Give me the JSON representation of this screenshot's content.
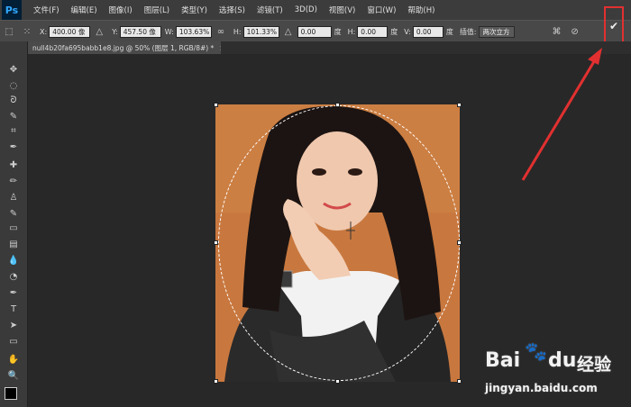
{
  "app": {
    "logo": "Ps"
  },
  "menu": [
    "文件(F)",
    "编辑(E)",
    "图像(I)",
    "图层(L)",
    "类型(Y)",
    "选择(S)",
    "滤镜(T)",
    "3D(D)",
    "视图(V)",
    "窗口(W)",
    "帮助(H)"
  ],
  "options": {
    "x_label": "X:",
    "x_value": "400.00 像",
    "y_label": "Y:",
    "y_value": "457.50 像",
    "w_label": "W:",
    "w_value": "103.63%",
    "h_label": "H:",
    "h_value": "101.33%",
    "angle_value": "0.00",
    "angle_unit": "度",
    "hskew_label": "H:",
    "hskew_value": "0.00",
    "hskew_unit": "度",
    "vskew_label": "V:",
    "vskew_value": "0.00",
    "vskew_unit": "度",
    "interp_label": "插值:",
    "interp_value": "两次立方"
  },
  "document_tab": {
    "title": "null4b20fa695babb1e8.jpg @ 50% (图层 1, RGB/8#) *",
    "close": "×"
  },
  "tools": [
    "move-tool",
    "marquee-tool",
    "lasso-tool",
    "quick-select-tool",
    "crop-tool",
    "eyedropper-tool",
    "healing-tool",
    "brush-tool",
    "stamp-tool",
    "history-brush-tool",
    "eraser-tool",
    "gradient-tool",
    "blur-tool",
    "dodge-tool",
    "pen-tool",
    "type-tool",
    "path-select-tool",
    "shape-tool",
    "hand-tool",
    "zoom-tool"
  ],
  "tool_glyphs": [
    "✥",
    "◌",
    "ᘐ",
    "✎",
    "⌗",
    "✒",
    "✚",
    "✏",
    "♙",
    "✎",
    "▭",
    "▤",
    "💧",
    "◔",
    "✒",
    "T",
    "➤",
    "▭",
    "✋",
    "🔍"
  ],
  "watermark": {
    "brand": "Bai",
    "brand2": "du",
    "cn": "经验",
    "url": "jingyan.baidu.com"
  },
  "colors": {
    "commit_highlight": "#e23030",
    "arrow": "#e23030",
    "backdrop": "#c8783f"
  }
}
